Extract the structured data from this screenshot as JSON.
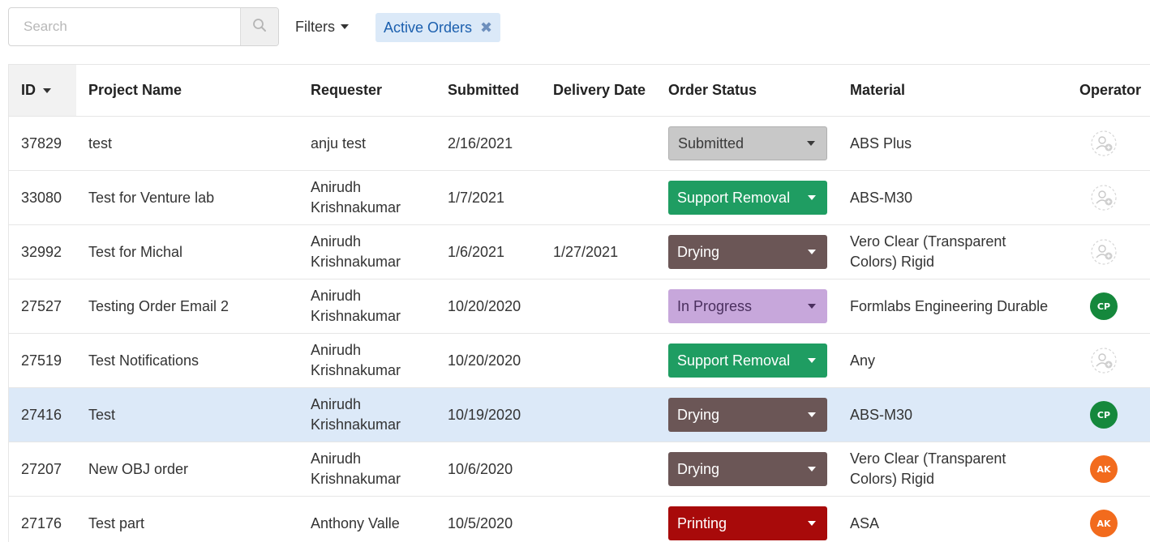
{
  "search": {
    "placeholder": "Search",
    "value": ""
  },
  "filters_label": "Filters",
  "active_chip": {
    "label": "Active Orders",
    "remove_glyph": "✖"
  },
  "colors": {
    "submitted": "#c8c8c8",
    "support_removal": "#1f9d62",
    "drying": "#6b5656",
    "in_progress": "#c7a7db",
    "printing": "#a80a0a",
    "avatar_cp": "#15883c",
    "avatar_ak": "#f26b1d",
    "selected_row": "#dce9f8"
  },
  "table": {
    "headers": {
      "id": "ID",
      "name": "Project Name",
      "requester": "Requester",
      "submitted": "Submitted",
      "delivery": "Delivery Date",
      "status": "Order Status",
      "material": "Material",
      "operator": "Operator"
    },
    "rows": [
      {
        "id": "37829",
        "name": "test",
        "requester": "anju test",
        "submitted": "2/16/2021",
        "delivery": "",
        "status": "Submitted",
        "status_key": "submitted",
        "material": "ABS Plus",
        "operator": "",
        "operator_icon": "assign-operator-icon"
      },
      {
        "id": "33080",
        "name": "Test for Venture lab",
        "requester": "Anirudh Krishnakumar",
        "submitted": "1/7/2021",
        "delivery": "",
        "status": "Support Removal",
        "status_key": "support_removal",
        "material": "ABS-M30",
        "operator": "",
        "operator_icon": "assign-operator-icon"
      },
      {
        "id": "32992",
        "name": "Test for Michal",
        "requester": "Anirudh Krishnakumar",
        "submitted": "1/6/2021",
        "delivery": "1/27/2021",
        "status": "Drying",
        "status_key": "drying",
        "material": "Vero Clear (Transparent Colors) Rigid",
        "operator": "",
        "operator_icon": "assign-operator-icon"
      },
      {
        "id": "27527",
        "name": "Testing Order Email 2",
        "requester": "Anirudh Krishnakumar",
        "submitted": "10/20/2020",
        "delivery": "",
        "status": "In Progress",
        "status_key": "in_progress",
        "material": "Formlabs Engineering Durable",
        "operator": "CP",
        "operator_icon": ""
      },
      {
        "id": "27519",
        "name": "Test Notifications",
        "requester": "Anirudh Krishnakumar",
        "submitted": "10/20/2020",
        "delivery": "",
        "status": "Support Removal",
        "status_key": "support_removal",
        "material": "Any",
        "operator": "",
        "operator_icon": "assign-operator-icon"
      },
      {
        "id": "27416",
        "name": "Test",
        "requester": "Anirudh Krishnakumar",
        "submitted": "10/19/2020",
        "delivery": "",
        "status": "Drying",
        "status_key": "drying",
        "material": "ABS-M30",
        "operator": "CP",
        "operator_icon": "",
        "selected": true
      },
      {
        "id": "27207",
        "name": "New OBJ order",
        "requester": "Anirudh Krishnakumar",
        "submitted": "10/6/2020",
        "delivery": "",
        "status": "Drying",
        "status_key": "drying",
        "material": "Vero Clear (Transparent Colors) Rigid",
        "operator": "AK",
        "operator_icon": ""
      },
      {
        "id": "27176",
        "name": "Test part",
        "requester": "Anthony Valle",
        "submitted": "10/5/2020",
        "delivery": "",
        "status": "Printing",
        "status_key": "printing",
        "material": "ASA",
        "operator": "AK",
        "operator_icon": ""
      }
    ]
  }
}
